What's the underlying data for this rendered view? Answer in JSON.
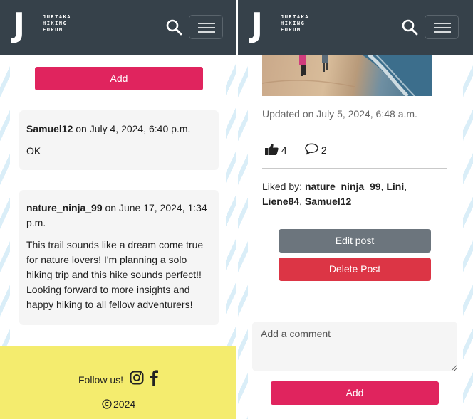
{
  "brand": {
    "letter": "J",
    "line1": "JURTAKA",
    "line2": "HIKING",
    "line3": "FORUM"
  },
  "left": {
    "add_label": "Add",
    "comments": [
      {
        "author": "Samuel12",
        "date": " on July 4, 2024, 6:40 p.m.",
        "text": "OK"
      },
      {
        "author": "nature_ninja_99",
        "date": " on June 17, 2024, 1:34 p.m.",
        "text": "This trail sounds like a dream come true for nature lovers! I'm planning a solo hiking trip and this hike sounds perfect!! Looking forward to more insights and happy hiking to all fellow adventurers!"
      }
    ],
    "footer": {
      "follow": "Follow us!",
      "copyright": "2024"
    }
  },
  "right": {
    "updated": "Updated on July 5, 2024, 6:48 a.m.",
    "likes_count": "4",
    "comments_count": "2",
    "liked_by_label": "Liked by: ",
    "liked_by": [
      "nature_ninja_99",
      "Lini",
      "Liene84",
      "Samuel12"
    ],
    "edit_label": "Edit post",
    "delete_label": "Delete Post",
    "comment_placeholder": "Add a comment",
    "add_label": "Add"
  },
  "colors": {
    "header": "#36414a",
    "accent": "#e0245e",
    "footer": "#f4ec6e",
    "delete": "#dc3545",
    "edit": "#6c757d"
  }
}
